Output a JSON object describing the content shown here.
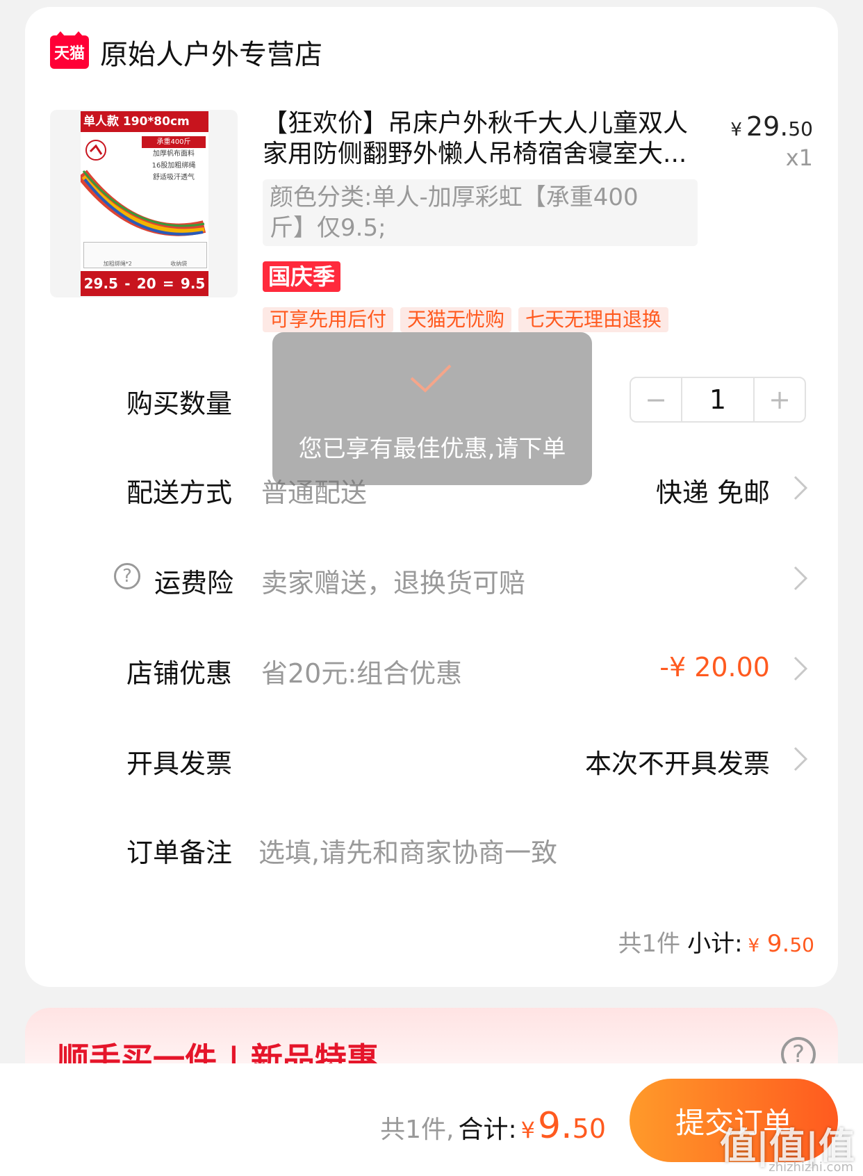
{
  "shop": {
    "logo_text": "天猫",
    "name": "原始人户外专营店"
  },
  "product": {
    "thumb": {
      "tag": "单人款  190*80cm",
      "features": [
        "承重400斤",
        "加厚帆布面料",
        "16股加粗绑绳",
        "舒适吸汗透气"
      ],
      "gift_labels": [
        "加粗绑绳*2",
        "收纳袋"
      ],
      "price_a": "29.5",
      "minus": "-",
      "price_b": "20",
      "equals": "=",
      "price_c": "9.5"
    },
    "title_line1": "【狂欢价】吊床户外秋千大人儿童双人",
    "title_line2": "家用防侧翻野外懒人吊椅宿舍寝室大...",
    "price_yen": "¥",
    "price_int": "29.",
    "price_dec": "50",
    "quantity_label": "x1",
    "sku_line1": "颜色分类:单人-加厚彩虹【承重400",
    "sku_line2": "斤】仅9.5;",
    "festival_badge": "国庆季",
    "service_tags": [
      "可享先用后付",
      "天猫无忧购",
      "七天无理由退换"
    ]
  },
  "rows": {
    "quantity": {
      "label": "购买数量",
      "minus": "−",
      "value": "1",
      "plus": "+"
    },
    "delivery": {
      "label": "配送方式",
      "value": "普通配送",
      "right": "快递 免邮"
    },
    "insurance": {
      "icon_glyph": "?",
      "label": "运费险",
      "value": "卖家赠送，退换货可赔"
    },
    "shop_discount": {
      "label": "店铺优惠",
      "value": "省20元:组合优惠",
      "right": "-¥ 20.00"
    },
    "invoice": {
      "label": "开具发票",
      "right": "本次不开具发票"
    },
    "remark": {
      "label": "订单备注",
      "placeholder": "选填,请先和商家协商一致"
    }
  },
  "subtotal": {
    "count_text": "共1件",
    "label": "小计:",
    "yen": "¥",
    "int": "9.",
    "dec": "50"
  },
  "toast": {
    "message": "您已享有最佳优惠,请下单"
  },
  "recommend": {
    "title": "顺手买一件 | 新品特惠",
    "help_glyph": "?"
  },
  "bottom_bar": {
    "count_text": "共1件,",
    "total_label": "合计:",
    "yen": "¥",
    "int": "9.",
    "dec": "50",
    "submit_label": "提交订单",
    "watermark": "值|值|值",
    "watermark_site": "zhizhizhi.com"
  },
  "colors": {
    "accent": "#ff5a1f",
    "tmall_red": "#ff0036",
    "festival_red": "#ff2a3c"
  }
}
